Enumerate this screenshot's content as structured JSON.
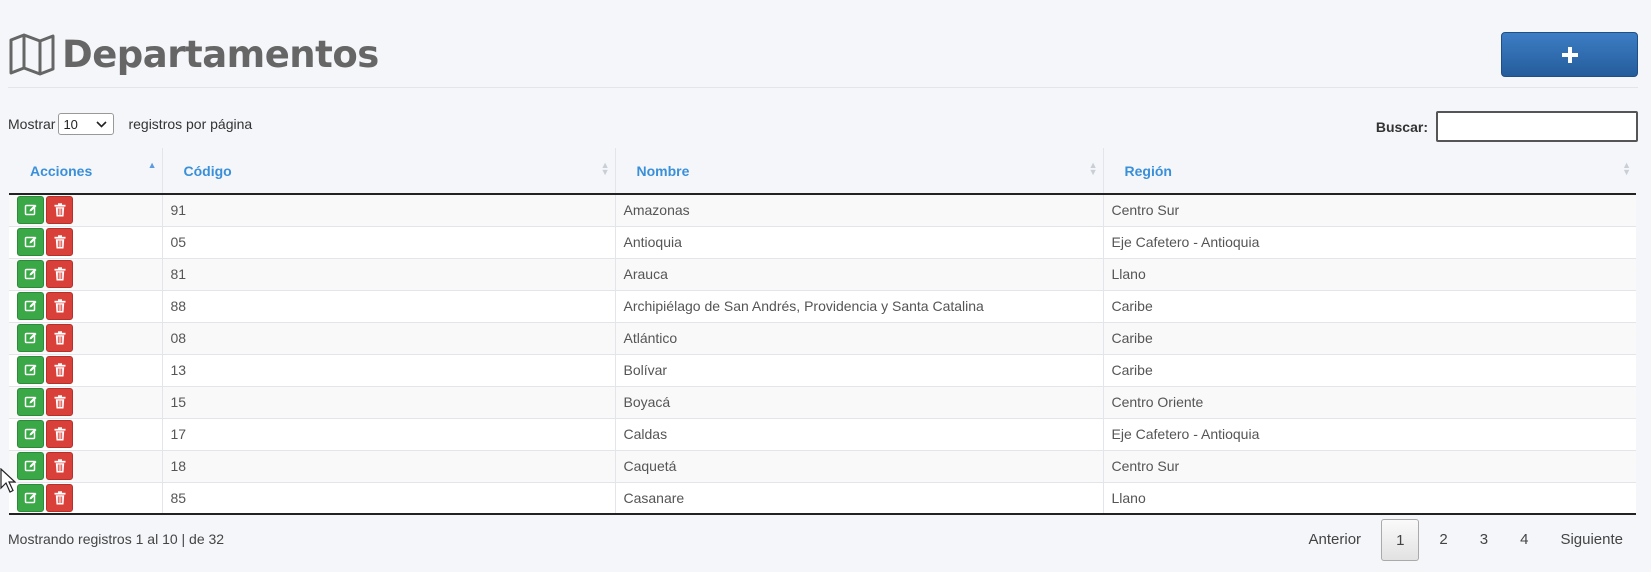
{
  "page": {
    "title": "Departamentos",
    "add_button_label": "+"
  },
  "length": {
    "prefix": "Mostrar",
    "selected": "10",
    "suffix": "registros por página"
  },
  "search": {
    "label": "Buscar:",
    "value": ""
  },
  "table": {
    "columns": [
      "Acciones",
      "Código",
      "Nombre",
      "Región"
    ],
    "rows": [
      {
        "codigo": "91",
        "nombre": "Amazonas",
        "region": "Centro Sur"
      },
      {
        "codigo": "05",
        "nombre": "Antioquia",
        "region": "Eje Cafetero - Antioquia"
      },
      {
        "codigo": "81",
        "nombre": "Arauca",
        "region": "Llano"
      },
      {
        "codigo": "88",
        "nombre": "Archipiélago de San Andrés, Providencia y Santa Catalina",
        "region": "Caribe"
      },
      {
        "codigo": "08",
        "nombre": "Atlántico",
        "region": "Caribe"
      },
      {
        "codigo": "13",
        "nombre": "Bolívar",
        "region": "Caribe"
      },
      {
        "codigo": "15",
        "nombre": "Boyacá",
        "region": "Centro Oriente"
      },
      {
        "codigo": "17",
        "nombre": "Caldas",
        "region": "Eje Cafetero - Antioquia"
      },
      {
        "codigo": "18",
        "nombre": "Caquetá",
        "region": "Centro Sur"
      },
      {
        "codigo": "85",
        "nombre": "Casanare",
        "region": "Llano"
      }
    ]
  },
  "footer": {
    "info": "Mostrando registros 1 al 10 | de 32"
  },
  "pagination": {
    "prev": "Anterior",
    "pages": [
      "1",
      "2",
      "3",
      "4"
    ],
    "current": "1",
    "next": "Siguiente"
  },
  "colors": {
    "accent": "#3a8fd9",
    "edit": "#3aa847",
    "delete": "#d9403a",
    "primary": "#2e6db0"
  }
}
